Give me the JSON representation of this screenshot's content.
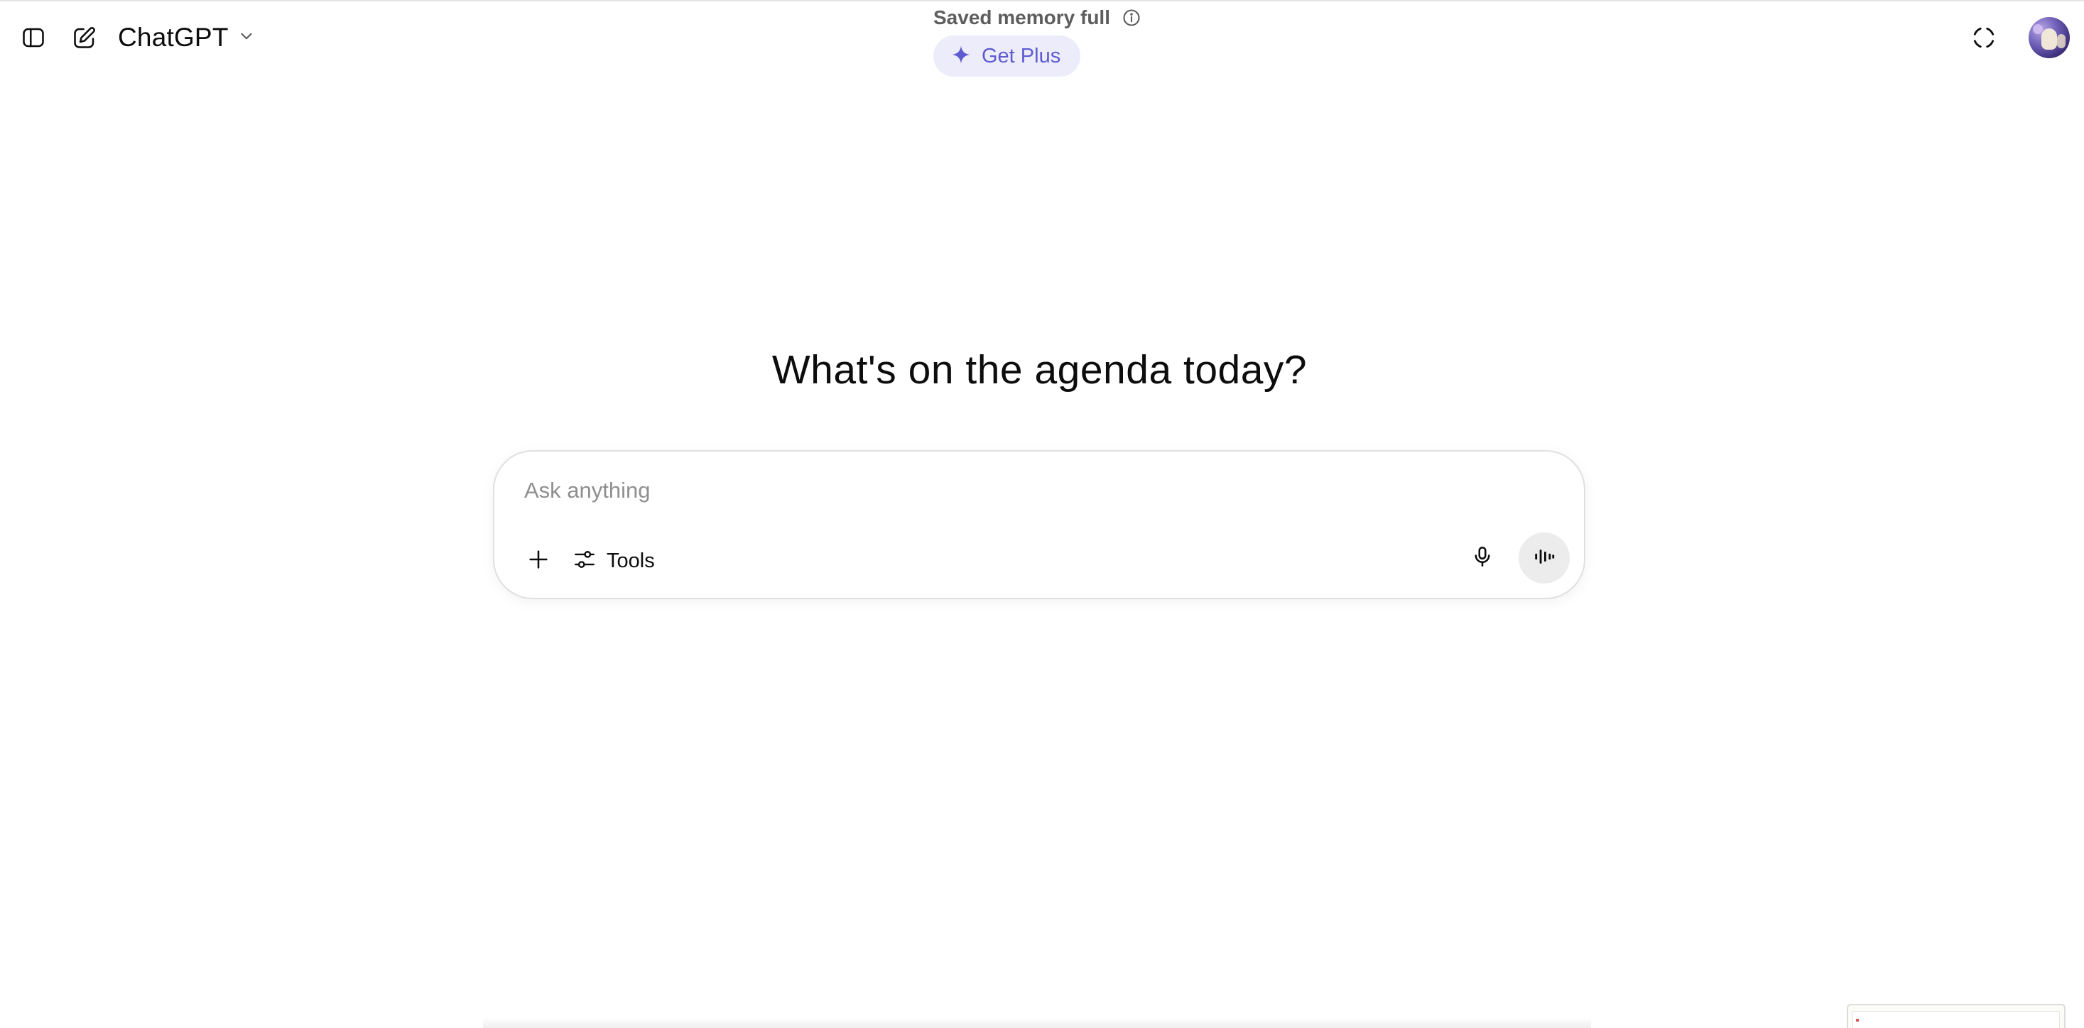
{
  "header": {
    "model_name": "ChatGPT",
    "memory_status": "Saved memory full",
    "upgrade_label": "Get Plus"
  },
  "main": {
    "headline": "What's on the agenda today?",
    "composer": {
      "placeholder": "Ask anything",
      "value": "",
      "tools_label": "Tools"
    }
  },
  "icons": {
    "sidebar_toggle": "sidebar-toggle-icon",
    "new_chat": "edit-icon",
    "model_chevron": "chevron-down-icon",
    "info": "info-icon",
    "upgrade": "sparkle-icon",
    "temporary_chat": "dashed-circle-icon",
    "attach": "plus-icon",
    "tools": "sliders-icon",
    "dictate": "microphone-icon",
    "voice_mode": "voice-wave-icon"
  },
  "colors": {
    "accent": "#5e5bd0",
    "accent_bg": "#ececfb",
    "text_primary": "#0d0d0d",
    "text_muted": "#5d5d5d",
    "placeholder": "#8f8f8f"
  }
}
